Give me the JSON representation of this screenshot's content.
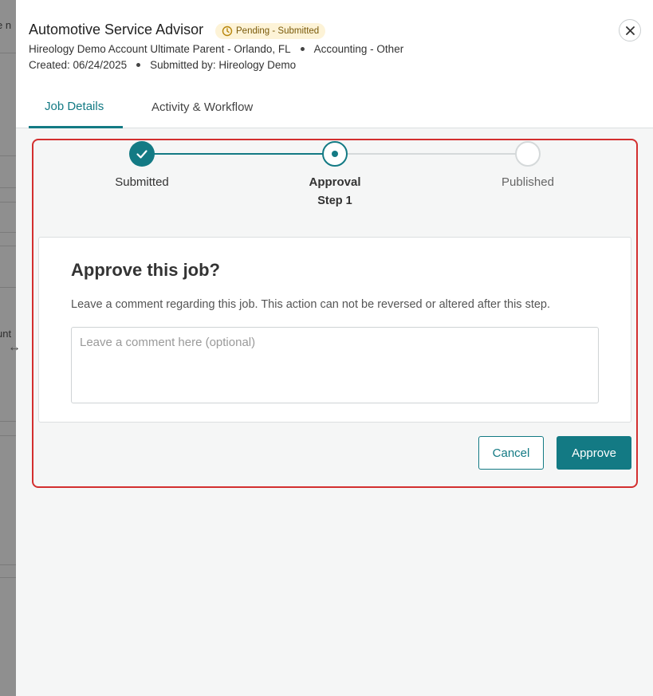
{
  "background": {
    "partial_text_top": "e n",
    "partial_text_mid": "unt"
  },
  "drawer": {
    "title": "Automotive Service Advisor",
    "status_badge": "Pending - Submitted",
    "location": "Hireology Demo Account Ultimate Parent - Orlando, FL",
    "category": "Accounting - Other",
    "created": "Created: 06/24/2025",
    "submitted_by": "Submitted by: Hireology Demo",
    "close_icon": "close-icon",
    "tabs": [
      {
        "label": "Job Details",
        "active": true
      },
      {
        "label": "Activity & Workflow",
        "active": false
      }
    ]
  },
  "stepper": {
    "steps": [
      {
        "label": "Submitted",
        "sublabel": "",
        "state": "complete"
      },
      {
        "label": "Approval",
        "sublabel": "Step 1",
        "state": "current"
      },
      {
        "label": "Published",
        "sublabel": "",
        "state": "upcoming"
      }
    ]
  },
  "approval": {
    "title": "Approve this job?",
    "description": "Leave a comment regarding this job. This action can not be reversed or altered after this step.",
    "comment_placeholder": "Leave a comment here (optional)",
    "comment_value": "",
    "cancel_label": "Cancel",
    "approve_label": "Approve"
  },
  "colors": {
    "accent": "#137a84",
    "highlight": "#d32f2f",
    "badge_bg": "#fdf3d7",
    "badge_text": "#7a5a0a"
  }
}
